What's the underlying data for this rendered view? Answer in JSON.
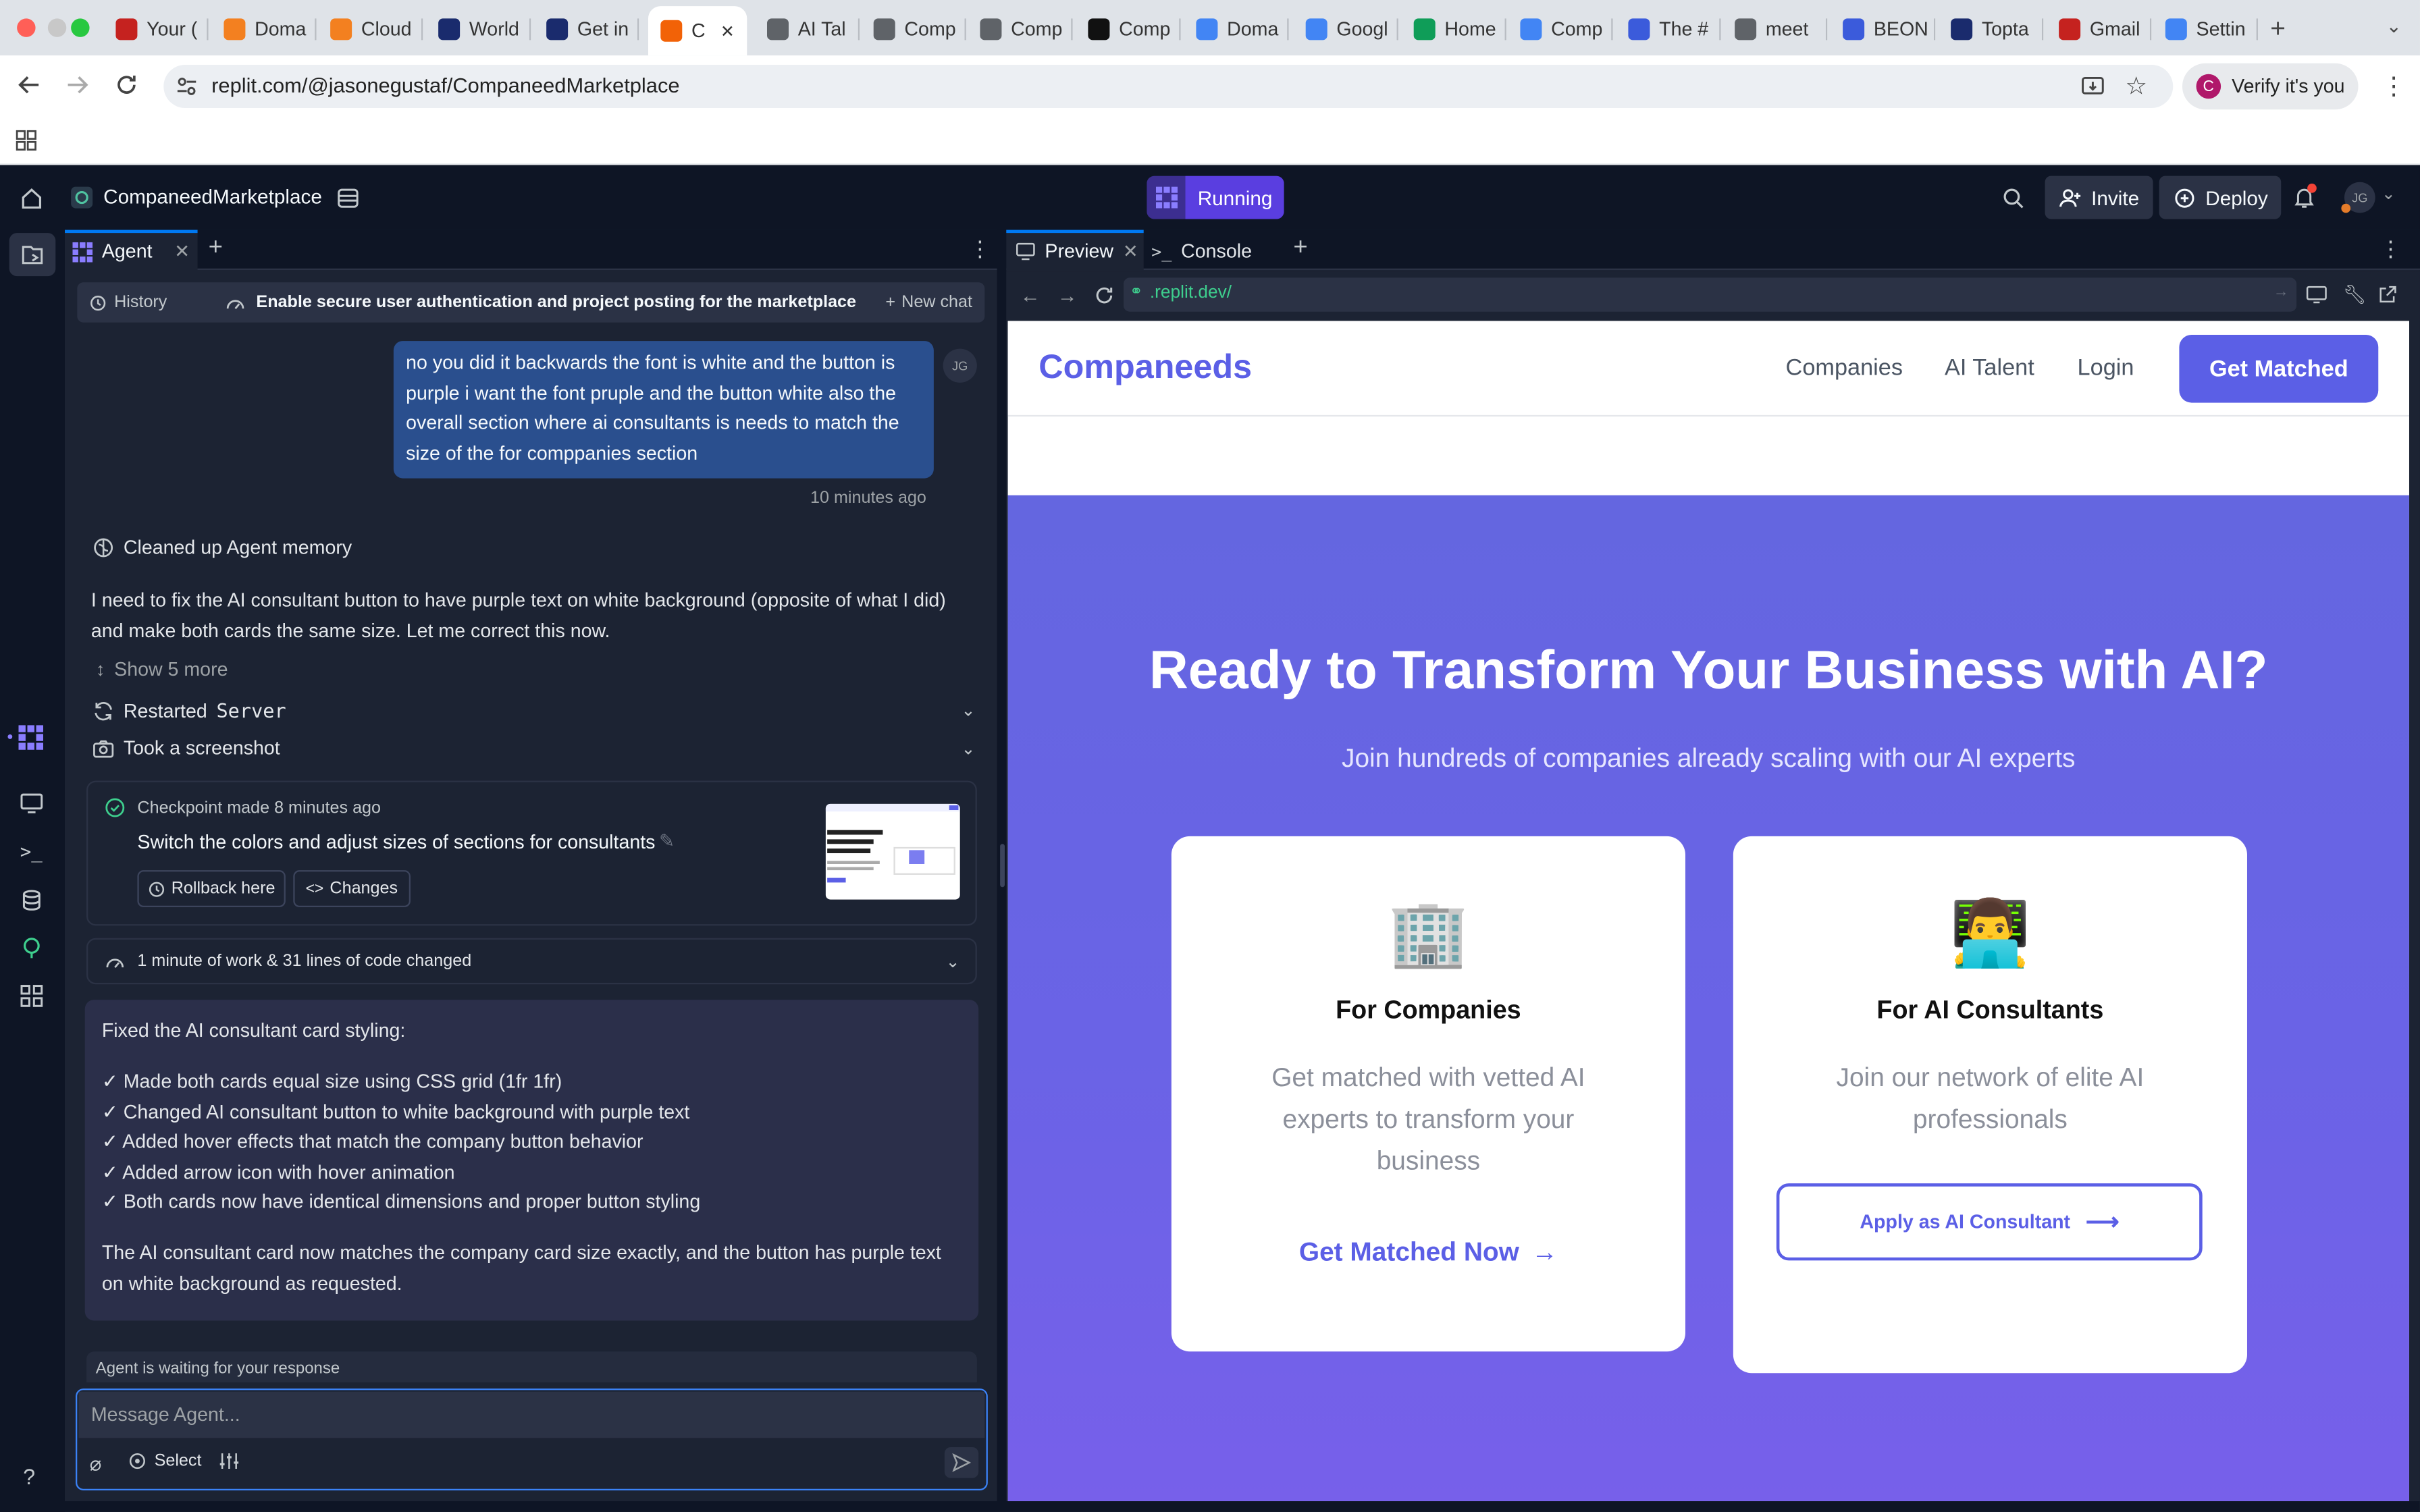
{
  "browser": {
    "tabs": [
      {
        "label": "Your (",
        "color": "#c5221f"
      },
      {
        "label": "Doma",
        "color": "#f38020"
      },
      {
        "label": "Cloud",
        "color": "#f38020"
      },
      {
        "label": "World",
        "color": "#1a2b6d"
      },
      {
        "label": "Get in",
        "color": "#1a2b6d"
      },
      {
        "label": "C",
        "color": "#f26207"
      },
      {
        "label": "AI Tal",
        "color": "#5f6368"
      },
      {
        "label": "Comp",
        "color": "#5f6368"
      },
      {
        "label": "Comp",
        "color": "#5f6368"
      },
      {
        "label": "Comp",
        "color": "#111111"
      },
      {
        "label": "Doma",
        "color": "#4285f4"
      },
      {
        "label": "Googl",
        "color": "#4285f4"
      },
      {
        "label": "Home",
        "color": "#0f9d58"
      },
      {
        "label": "Comp",
        "color": "#4285f4"
      },
      {
        "label": "The #",
        "color": "#3b5bdb"
      },
      {
        "label": "meet",
        "color": "#5f6368"
      },
      {
        "label": "BEON",
        "color": "#3b5bdb"
      },
      {
        "label": "Topta",
        "color": "#1a2b6d"
      },
      {
        "label": "Gmail",
        "color": "#c5221f"
      },
      {
        "label": "Settin",
        "color": "#4285f4"
      }
    ],
    "url": "replit.com/@jasonegustaf/CompaneedMarketplace",
    "verify_label": "Verify it's you",
    "verify_avatar": "C"
  },
  "replit": {
    "repl_name": "CompaneedMarketplace",
    "status": "Running",
    "invite_label": "Invite",
    "deploy_label": "Deploy",
    "avatar": "JG",
    "left_tab": "Agent",
    "history_label": "History",
    "thread_title": "Enable secure user authentication and project posting for the marketplace",
    "new_chat_label": "New chat",
    "preview_tab": "Preview",
    "console_tab": "Console",
    "preview_url": ".replit.dev/"
  },
  "chat": {
    "user_message": "no you did it backwards the font is white and the button is purple i want the font pruple and the button white also the overall section where ai consultants is needs to match the size of the for comppanies section",
    "user_avatar": "JG",
    "user_time": "10 minutes ago",
    "memory_label": "Cleaned up Agent memory",
    "agent_intro": "I need to fix the AI consultant button to have purple text on white background (opposite of what I did) and make both cards the same size. Let me correct this now.",
    "show_more": "Show 5 more",
    "restarted_prefix": "Restarted",
    "restarted_name": "Server",
    "screenshot_label": "Took a screenshot",
    "checkpoint_meta": "Checkpoint made 8 minutes ago",
    "checkpoint_title": "Switch the colors and adjust sizes of sections for consultants",
    "rollback_label": "Rollback here",
    "changes_label": "Changes",
    "work_summary": "1 minute of work & 31 lines of code changed",
    "summary_heading": "Fixed the AI consultant card styling:",
    "summary_items": [
      "✓ Made both cards equal size using CSS grid (1fr 1fr)",
      "✓ Changed AI consultant button to white background with purple text",
      "✓ Added hover effects that match the company button behavior",
      "✓ Added arrow icon with hover animation",
      "✓ Both cards now have identical dimensions and proper button styling"
    ],
    "summary_footer": "The AI consultant card now matches the company card size exactly, and the button has purple text on white background as requested.",
    "waiting": "Agent is waiting for your response",
    "input_placeholder": "Message Agent...",
    "select_label": "Select"
  },
  "site": {
    "brand": "Companeeds",
    "nav": [
      "Companies",
      "AI Talent",
      "Login"
    ],
    "cta": "Get Matched",
    "hero_title": "Ready to Transform Your Business with AI?",
    "hero_sub": "Join hundreds of companies already scaling with our AI experts",
    "cards": [
      {
        "emoji": "🏢",
        "title": "For Companies",
        "text": "Get matched with vetted AI experts to transform your business",
        "action": "Get Matched Now"
      },
      {
        "emoji": "👨‍💻",
        "title": "For AI Consultants",
        "text": "Join our network of elite AI professionals",
        "action": "Apply as AI Consultant"
      }
    ],
    "accent": "#5b5fe6"
  }
}
